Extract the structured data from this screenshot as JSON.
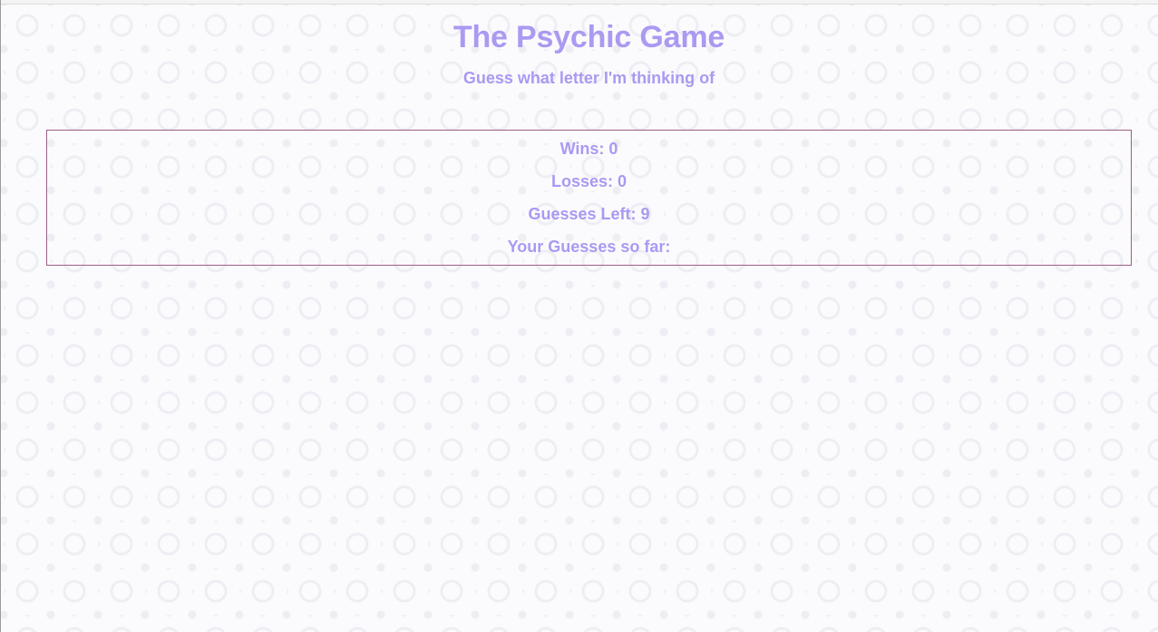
{
  "header": {
    "title": "The Psychic Game",
    "subtitle": "Guess what letter I'm thinking of"
  },
  "stats": {
    "wins_label": "Wins:",
    "wins_value": "0",
    "losses_label": "Losses:",
    "losses_value": "0",
    "guesses_left_label": "Guesses Left:",
    "guesses_left_value": "9",
    "guesses_so_far_label": "Your Guesses so far:",
    "guesses_so_far_value": ""
  },
  "colors": {
    "text_accent": "#ab99f2",
    "box_border": "#9c5f86",
    "background": "#fbfbfd",
    "pattern": "#e2e4ec"
  }
}
